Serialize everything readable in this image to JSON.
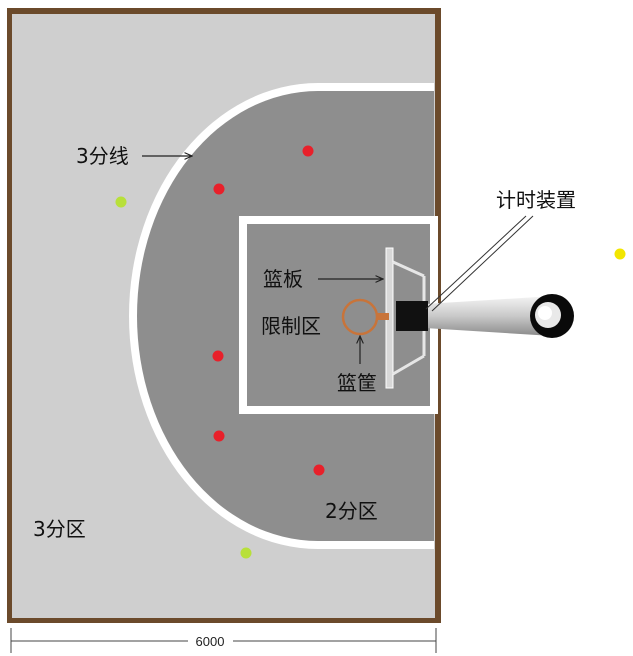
{
  "labels": {
    "three_point_line": "3分线",
    "timer_device": "计时装置",
    "backboard": "篮板",
    "restricted_area": "限制区",
    "hoop": "篮筐",
    "two_point_zone": "2分区",
    "three_point_zone": "3分区"
  },
  "dimension": {
    "width_label": "6000"
  },
  "colors": {
    "frame": "#6b4a2b",
    "court_outer": "#cfcfcf",
    "court_inner": "#8e8e8e",
    "lines": "#ffffff",
    "red_dot": "#e8202a",
    "green_dot": "#b8e03a",
    "yellow_dot": "#f2e600",
    "hoop": "#c8743a"
  },
  "markers": [
    {
      "zone": "2分区",
      "color": "red"
    },
    {
      "zone": "2分区",
      "color": "red"
    },
    {
      "zone": "2分区",
      "color": "red"
    },
    {
      "zone": "2分区",
      "color": "red"
    },
    {
      "zone": "2分区",
      "color": "red"
    },
    {
      "zone": "3分区",
      "color": "green"
    },
    {
      "zone": "3分区",
      "color": "green"
    },
    {
      "zone": "outside",
      "color": "yellow"
    }
  ]
}
